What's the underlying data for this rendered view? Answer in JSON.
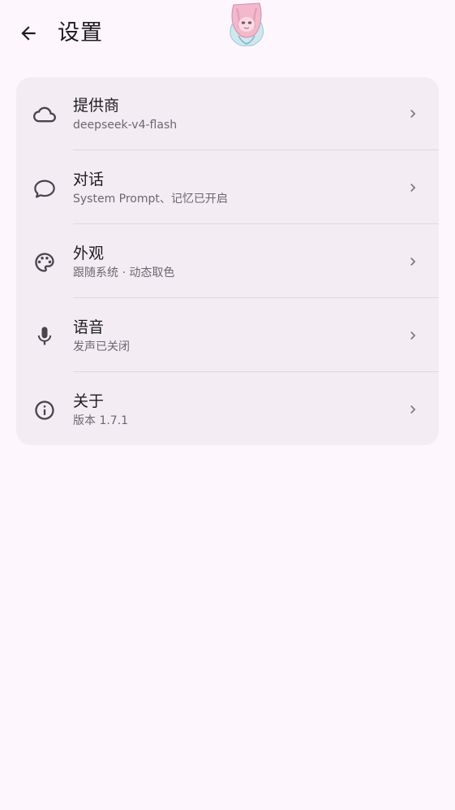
{
  "header": {
    "title": "设置"
  },
  "settings": [
    {
      "title": "提供商",
      "subtitle": "deepseek-v4-flash",
      "icon": "cloud-icon"
    },
    {
      "title": "对话",
      "subtitle": "System Prompt、记忆已开启",
      "icon": "chat-bubble-icon"
    },
    {
      "title": "外观",
      "subtitle": "跟随系统 · 动态取色",
      "icon": "palette-icon"
    },
    {
      "title": "语音",
      "subtitle": "发声已关闭",
      "icon": "microphone-icon"
    },
    {
      "title": "关于",
      "subtitle": "版本 1.7.1",
      "icon": "info-icon"
    }
  ],
  "colors": {
    "background": "#fdf7fd",
    "card": "#f3edf3",
    "icon": "#48454e",
    "subtitle": "#6b6670"
  }
}
